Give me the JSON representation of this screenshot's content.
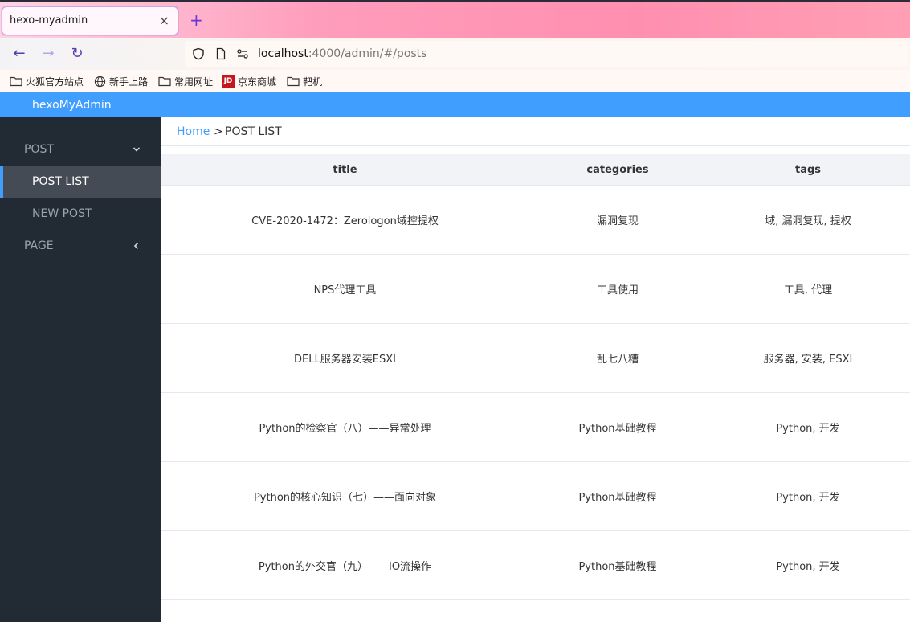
{
  "browser": {
    "tab_title": "hexo-myadmin",
    "url_host": "localhost",
    "url_path": ":4000/admin/#/posts",
    "bookmarks": [
      {
        "label": "火狐官方站点",
        "icon": "folder-icon"
      },
      {
        "label": "新手上路",
        "icon": "globe-icon"
      },
      {
        "label": "常用网址",
        "icon": "folder-icon"
      },
      {
        "label": "京东商城",
        "icon": "jd-icon"
      },
      {
        "label": "靶机",
        "icon": "folder-icon"
      }
    ],
    "jd_badge": "JD"
  },
  "app": {
    "title": "hexoMyAdmin",
    "accent": "#409eff",
    "sidebar": {
      "items": [
        {
          "label": "POST"
        },
        {
          "label": "POST LIST"
        },
        {
          "label": "NEW POST"
        },
        {
          "label": "PAGE"
        }
      ]
    },
    "breadcrumb": {
      "home": "Home",
      "sep": ">",
      "current": "POST LIST"
    },
    "table": {
      "headers": {
        "title": "title",
        "categories": "categories",
        "tags": "tags"
      },
      "rows": [
        {
          "title": "CVE-2020-1472：Zerologon域控提权",
          "categories": "漏洞复现",
          "tags": "域, 漏洞复现, 提权"
        },
        {
          "title": "NPS代理工具",
          "categories": "工具使用",
          "tags": "工具, 代理"
        },
        {
          "title": "DELL服务器安装ESXI",
          "categories": "乱七八糟",
          "tags": "服务器, 安装, ESXI"
        },
        {
          "title": "Python的检察官（八）——异常处理",
          "categories": "Python基础教程",
          "tags": "Python, 开发"
        },
        {
          "title": "Python的核心知识（七）——面向对象",
          "categories": "Python基础教程",
          "tags": "Python, 开发"
        },
        {
          "title": "Python的外交官（九）——IO流操作",
          "categories": "Python基础教程",
          "tags": "Python, 开发"
        }
      ]
    }
  }
}
